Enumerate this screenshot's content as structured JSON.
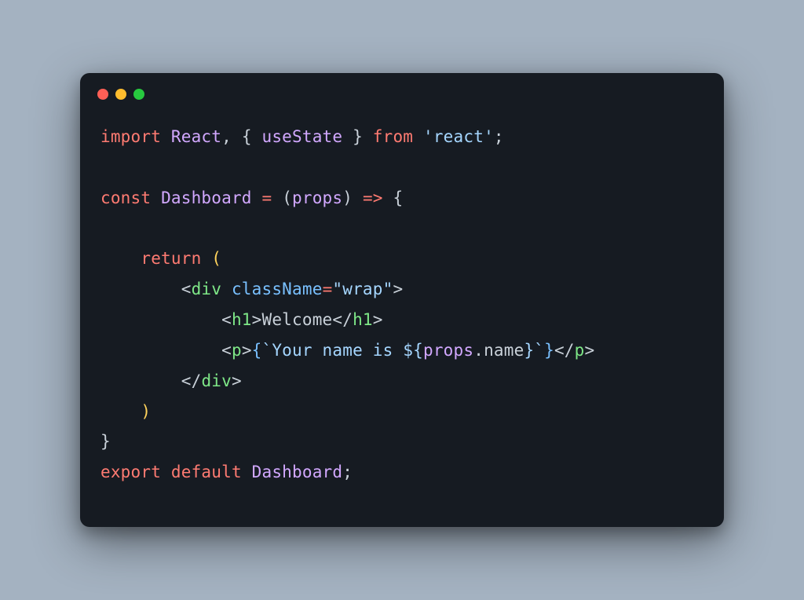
{
  "code": {
    "line1": {
      "import": "import",
      "react": "React",
      "comma": ",",
      "brace_open": "{",
      "useState": "useState",
      "brace_close": "}",
      "from": "from",
      "quote1": "'",
      "module": "react",
      "quote2": "'",
      "semi": ";"
    },
    "line3": {
      "const": "const",
      "name": "Dashboard",
      "eq": "=",
      "paren_open": "(",
      "props": "props",
      "paren_close": ")",
      "arrow": "=>",
      "brace": "{"
    },
    "line5": {
      "return": "return",
      "paren": "("
    },
    "line6": {
      "lt": "<",
      "div": "div",
      "className": "className",
      "eq": "=",
      "quote1": "\"",
      "wrap": "wrap",
      "quote2": "\"",
      "gt": ">"
    },
    "line7": {
      "lt": "<",
      "h1": "h1",
      "gt": ">",
      "welcome": "Welcome",
      "lt2": "</",
      "h1_2": "h1",
      "gt2": ">"
    },
    "line8": {
      "lt": "<",
      "p": "p",
      "gt": ">",
      "brace_open": "{",
      "tick1": "`",
      "text": "Your name is ",
      "dollar": "${",
      "props": "props",
      "dot": ".",
      "name": "name",
      "close_interp": "}",
      "tick2": "`",
      "brace_close": "}",
      "lt2": "</",
      "p2": "p",
      "gt2": ">"
    },
    "line9": {
      "lt": "</",
      "div": "div",
      "gt": ">"
    },
    "line10": {
      "paren": ")"
    },
    "line11": {
      "brace": "}"
    },
    "line12": {
      "export": "export",
      "default": "default",
      "name": "Dashboard",
      "semi": ";"
    }
  }
}
